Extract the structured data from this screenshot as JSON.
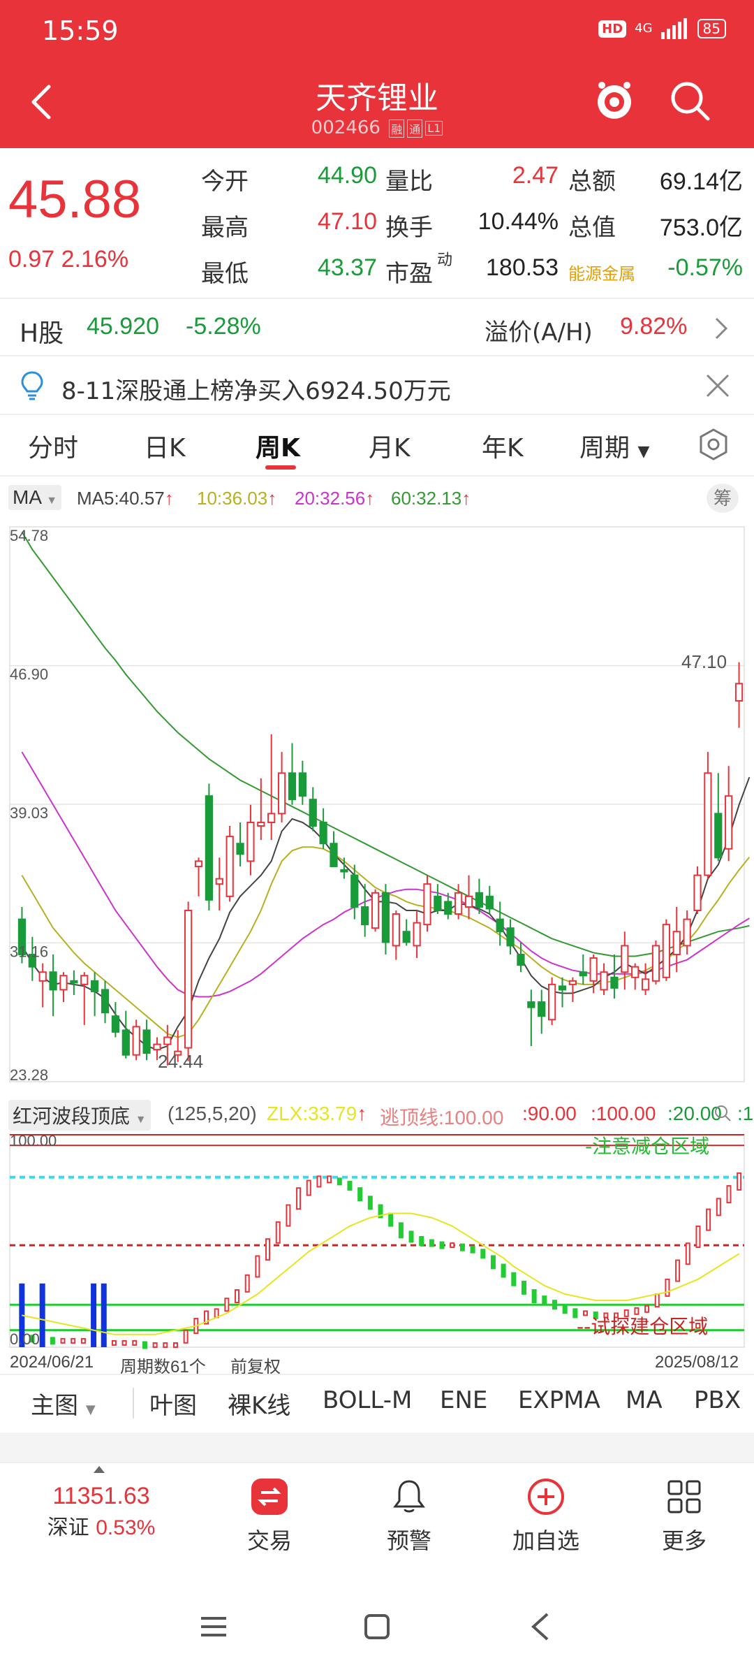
{
  "status_bar": {
    "time": "15:59",
    "network": "4G",
    "hd": "HD",
    "battery": "85"
  },
  "header": {
    "title": "天齐锂业",
    "code": "002466",
    "tags": [
      "融",
      "通",
      "L1"
    ]
  },
  "quote": {
    "price": "45.88",
    "change": "0.97",
    "change_pct": "2.16%",
    "rows": [
      {
        "l1": "今开",
        "v1": "44.90",
        "c1": "green",
        "l2": "量比",
        "v2": "2.47",
        "c2": "red",
        "l3": "总额",
        "v3": "69.14亿",
        "c3": "black"
      },
      {
        "l1": "最高",
        "v1": "47.10",
        "c1": "red",
        "l2": "换手",
        "v2": "10.44%",
        "c2": "black",
        "l3": "总值",
        "v3": "753.0亿",
        "c3": "black"
      },
      {
        "l1": "最低",
        "v1": "43.37",
        "c1": "green",
        "l2": "市盈",
        "v2": "180.53",
        "c2": "black",
        "l3": "能源金属",
        "v3": "-0.57%",
        "c3": "green"
      }
    ],
    "pe_superscript": "动"
  },
  "hshare": {
    "label": "H股",
    "price": "45.920",
    "pct": "-5.28%",
    "premium_label": "溢价(A/H)",
    "premium": "9.82%"
  },
  "notice": {
    "text": "8-11深股通上榜净买入6924.50万元"
  },
  "tabs": [
    {
      "label": "分时"
    },
    {
      "label": "日K"
    },
    {
      "label": "周K"
    },
    {
      "label": "月K"
    },
    {
      "label": "年K"
    },
    {
      "label": "周期"
    }
  ],
  "active_tab": "周K",
  "ma_legend": {
    "selector": "MA",
    "ma5": "MA5:40.57",
    "ma10": "10:36.03",
    "ma20": "20:32.56",
    "ma60": "60:32.13",
    "chip_button": "筹"
  },
  "colors": {
    "brand": "#e8333a",
    "up": "#e8333a",
    "down": "#1a9b3a",
    "ma5": "#444444",
    "ma10": "#b8b020",
    "ma20": "#cc33cc",
    "ma60": "#339933"
  },
  "price_axis": {
    "labels": [
      "54.78",
      "46.90",
      "39.03",
      "31.16",
      "23.28"
    ]
  },
  "chart_annotations": {
    "high": "47.10",
    "low": "24.44"
  },
  "chart_data": {
    "type": "candlestick",
    "period": "weekly",
    "ylim": [
      23.28,
      54.78
    ],
    "candles": [
      [
        32.5,
        33.2,
        30.0,
        30.5
      ],
      [
        30.5,
        31.5,
        29.0,
        29.8
      ],
      [
        29.0,
        30.0,
        27.5,
        29.5
      ],
      [
        29.5,
        30.5,
        27.0,
        28.5
      ],
      [
        28.5,
        29.5,
        27.8,
        29.3
      ],
      [
        29.0,
        29.6,
        28.2,
        28.9
      ],
      [
        28.8,
        29.5,
        26.5,
        29.3
      ],
      [
        29.0,
        29.5,
        27.0,
        28.4
      ],
      [
        28.5,
        29.0,
        26.6,
        27.2
      ],
      [
        27.0,
        27.8,
        25.8,
        26.1
      ],
      [
        26.2,
        27.3,
        24.6,
        24.8
      ],
      [
        24.8,
        26.8,
        24.5,
        26.4
      ],
      [
        26.2,
        26.8,
        24.5,
        24.9
      ],
      [
        25.1,
        25.8,
        24.5,
        25.4
      ],
      [
        25.4,
        26.5,
        24.2,
        25.8
      ],
      [
        24.8,
        26.2,
        24.4,
        25.0
      ],
      [
        25.2,
        33.5,
        24.44,
        33.0
      ],
      [
        35.5,
        36.0,
        33.8,
        35.8
      ],
      [
        39.5,
        40.2,
        33.0,
        33.6
      ],
      [
        34.5,
        36.0,
        33.0,
        34.8
      ],
      [
        33.8,
        37.8,
        33.5,
        37.2
      ],
      [
        36.8,
        38.0,
        35.5,
        36.2
      ],
      [
        35.8,
        39.0,
        35.0,
        38.0
      ],
      [
        37.8,
        40.5,
        37.0,
        38.0
      ],
      [
        38.0,
        43.0,
        37.0,
        38.5
      ],
      [
        38.5,
        42.0,
        38.0,
        40.8
      ],
      [
        40.8,
        42.5,
        39.0,
        39.3
      ],
      [
        40.8,
        41.5,
        39.0,
        39.5
      ],
      [
        39.3,
        40.0,
        37.5,
        37.8
      ],
      [
        38.0,
        38.8,
        36.5,
        36.8
      ],
      [
        36.8,
        37.5,
        35.5,
        35.5
      ],
      [
        35.3,
        36.0,
        34.8,
        35.2
      ],
      [
        35.0,
        35.6,
        32.5,
        33.2
      ],
      [
        33.2,
        34.5,
        31.5,
        32.2
      ],
      [
        32.0,
        34.2,
        31.8,
        34.0
      ],
      [
        34.0,
        34.5,
        30.5,
        31.2
      ],
      [
        31.0,
        33.0,
        30.2,
        32.8
      ],
      [
        31.8,
        32.5,
        31.0,
        31.2
      ],
      [
        31.0,
        33.0,
        30.3,
        32.3
      ],
      [
        32.2,
        35.0,
        31.8,
        34.5
      ],
      [
        33.8,
        34.5,
        32.8,
        33.0
      ],
      [
        33.5,
        34.0,
        32.5,
        32.8
      ],
      [
        32.8,
        34.5,
        32.5,
        34.0
      ],
      [
        33.2,
        35.0,
        32.5,
        33.8
      ],
      [
        34.0,
        34.8,
        32.8,
        33.2
      ],
      [
        33.8,
        34.4,
        32.8,
        33.1
      ],
      [
        32.5,
        33.5,
        31.0,
        31.8
      ],
      [
        32.0,
        32.5,
        30.5,
        31.0
      ],
      [
        30.5,
        31.2,
        29.5,
        29.9
      ],
      [
        27.8,
        28.5,
        25.3,
        27.5
      ],
      [
        27.8,
        28.5,
        26.0,
        27.0
      ],
      [
        26.8,
        29.2,
        26.5,
        28.8
      ],
      [
        28.7,
        29.2,
        27.5,
        28.5
      ],
      [
        28.8,
        29.2,
        27.8,
        29.0
      ],
      [
        29.5,
        30.5,
        28.8,
        29.3
      ],
      [
        29.0,
        30.5,
        28.3,
        30.3
      ],
      [
        28.5,
        30.0,
        28.2,
        29.5
      ],
      [
        29.2,
        30.5,
        28.0,
        28.6
      ],
      [
        29.5,
        31.8,
        28.5,
        31.0
      ],
      [
        29.2,
        30.0,
        28.5,
        29.8
      ],
      [
        28.5,
        30.0,
        28.2,
        29.1
      ],
      [
        29.0,
        31.3,
        28.8,
        31.0
      ],
      [
        29.2,
        32.5,
        29.0,
        32.2
      ],
      [
        30.5,
        33.2,
        29.5,
        31.8
      ],
      [
        31.0,
        33.0,
        30.5,
        32.5
      ],
      [
        33.0,
        35.5,
        32.8,
        35.0
      ],
      [
        35.0,
        42.0,
        34.8,
        40.8
      ],
      [
        38.5,
        40.8,
        35.8,
        36.0
      ],
      [
        36.5,
        41.2,
        35.8,
        39.5
      ],
      [
        44.9,
        47.1,
        43.37,
        45.88
      ]
    ],
    "ma5": [
      31.0,
      30.0,
      29.2,
      28.8,
      28.9,
      28.8,
      28.7,
      28.4,
      28.0,
      27.1,
      26.3,
      25.8,
      25.3,
      25.1,
      25.3,
      26.4,
      27.3,
      29.0,
      30.3,
      31.4,
      32.9,
      33.8,
      34.4,
      35.0,
      35.8,
      37.5,
      38.2,
      38.0,
      37.6,
      37.0,
      36.2,
      35.6,
      35.0,
      34.2,
      33.5,
      33.5,
      33.4,
      33.0,
      33.0,
      32.8,
      33.0,
      33.0,
      33.4,
      33.3,
      33.1,
      32.8,
      32.1,
      31.2,
      30.3,
      29.3,
      28.7,
      28.4,
      28.3,
      28.3,
      28.5,
      28.7,
      29.2,
      29.5,
      30.0,
      29.7,
      29.4,
      29.8,
      30.3,
      30.8,
      31.6,
      33.0,
      34.8,
      35.6,
      37.1,
      39.0,
      40.57
    ],
    "ma10": [
      35.0,
      34.0,
      33.0,
      32.0,
      31.3,
      30.6,
      30.0,
      29.5,
      29.0,
      28.5,
      28.0,
      27.5,
      27.0,
      26.5,
      26.0,
      25.8,
      26.0,
      26.8,
      27.8,
      28.8,
      29.8,
      30.8,
      31.8,
      33.0,
      34.5,
      35.8,
      36.4,
      36.6,
      36.6,
      36.5,
      36.2,
      35.8,
      35.3,
      34.8,
      34.3,
      34.0,
      33.8,
      33.5,
      33.3,
      33.2,
      33.1,
      33.0,
      32.8,
      32.6,
      32.3,
      32.0,
      31.6,
      31.2,
      30.8,
      30.3,
      29.8,
      29.4,
      29.1,
      28.9,
      28.8,
      28.8,
      28.9,
      29.0,
      29.2,
      29.4,
      29.6,
      29.9,
      30.2,
      30.7,
      31.2,
      31.9,
      32.8,
      33.6,
      34.5,
      35.3,
      36.03
    ],
    "ma20": [
      42.0,
      41.0,
      40.0,
      39.0,
      38.0,
      37.0,
      36.0,
      35.0,
      34.0,
      33.0,
      32.2,
      31.4,
      30.6,
      29.8,
      29.1,
      28.5,
      28.2,
      28.1,
      28.1,
      28.2,
      28.4,
      28.7,
      29.0,
      29.4,
      29.9,
      30.4,
      30.9,
      31.4,
      31.8,
      32.2,
      32.5,
      32.9,
      33.2,
      33.5,
      33.7,
      33.9,
      34.1,
      34.2,
      34.2,
      34.1,
      34.0,
      33.8,
      33.6,
      33.3,
      33.0,
      32.6,
      32.2,
      31.7,
      31.2,
      30.7,
      30.3,
      30.0,
      29.8,
      29.6,
      29.5,
      29.4,
      29.4,
      29.4,
      29.4,
      29.4,
      29.5,
      29.6,
      29.8,
      30.0,
      30.2,
      30.6,
      31.0,
      31.4,
      31.8,
      32.2,
      32.56
    ],
    "ma60": [
      54.5,
      53.5,
      52.7,
      51.9,
      51.1,
      50.3,
      49.5,
      48.7,
      47.9,
      47.2,
      46.4,
      45.7,
      45.0,
      44.3,
      43.7,
      43.1,
      42.6,
      42.1,
      41.6,
      41.2,
      40.8,
      40.4,
      40.1,
      39.8,
      39.5,
      39.2,
      38.9,
      38.6,
      38.3,
      38.0,
      37.7,
      37.4,
      37.1,
      36.8,
      36.5,
      36.2,
      35.9,
      35.6,
      35.3,
      35.0,
      34.7,
      34.4,
      34.1,
      33.8,
      33.5,
      33.2,
      32.9,
      32.6,
      32.3,
      32.0,
      31.7,
      31.4,
      31.2,
      31.0,
      30.8,
      30.6,
      30.5,
      30.4,
      30.4,
      30.4,
      30.5,
      30.6,
      30.8,
      31.0,
      31.2,
      31.4,
      31.6,
      31.8,
      31.9,
      32.0,
      32.13
    ]
  },
  "sub_indicator": {
    "selector": "红河波段顶底",
    "params": "(125,5,20)",
    "zlx": "ZLX:33.79",
    "escape_line": "逃顶线:100.00",
    "v90": ":90.00",
    "v100": ":100.00",
    "v20": ":20.00",
    "v_trunc": ":1",
    "axis_top": "100.00",
    "axis_bottom": "0.00",
    "label_top": "-注意减仓区域",
    "label_bottom": "--试探建仓区域",
    "ylim": [
      0,
      100
    ],
    "bars": [
      5,
      4,
      4,
      3,
      3,
      3,
      3,
      2,
      2,
      2,
      2,
      2,
      1,
      1,
      1,
      1,
      5,
      10,
      14,
      16,
      20,
      24,
      30,
      38,
      46,
      54,
      62,
      70,
      75,
      78,
      79,
      78,
      76,
      72,
      68,
      64,
      60,
      55,
      52,
      50,
      49,
      48,
      48,
      47,
      46,
      44,
      40,
      36,
      32,
      28,
      24,
      22,
      20,
      18,
      16,
      16,
      15,
      15,
      15,
      16,
      17,
      18,
      22,
      28,
      36,
      44,
      52,
      60,
      66,
      72,
      78
    ],
    "blue_bars_at": [
      0,
      2,
      7,
      8
    ],
    "yellow_curve": [
      15,
      14,
      13,
      12,
      11,
      10,
      9,
      8,
      7,
      6,
      6,
      6,
      6,
      6,
      7,
      8,
      9,
      10,
      12,
      14,
      16,
      19,
      22,
      25,
      29,
      33,
      37,
      41,
      45,
      48,
      51,
      54,
      57,
      59,
      61,
      62,
      63,
      63,
      63,
      62,
      61,
      59,
      57,
      54,
      51,
      48,
      45,
      42,
      38,
      35,
      32,
      29,
      27,
      25,
      24,
      23,
      22,
      22,
      22,
      22,
      23,
      24,
      25,
      26,
      28,
      30,
      32,
      35,
      38,
      41,
      44
    ]
  },
  "date_bar": {
    "start": "2024/06/21",
    "count": "周期数61个",
    "adj": "前复权",
    "end": "2025/08/12"
  },
  "indicator_tabs": [
    "主图",
    "叶图",
    "裸K线",
    "BOLL-M",
    "ENE",
    "EXPMA",
    "MA",
    "PBX"
  ],
  "active_indicator": "MA",
  "bottom_nav": {
    "index_value": "11351.63",
    "index_name": "深证",
    "index_pct": "0.53%",
    "items": [
      {
        "label": "交易"
      },
      {
        "label": "预警"
      },
      {
        "label": "加自选"
      },
      {
        "label": "更多"
      }
    ]
  }
}
